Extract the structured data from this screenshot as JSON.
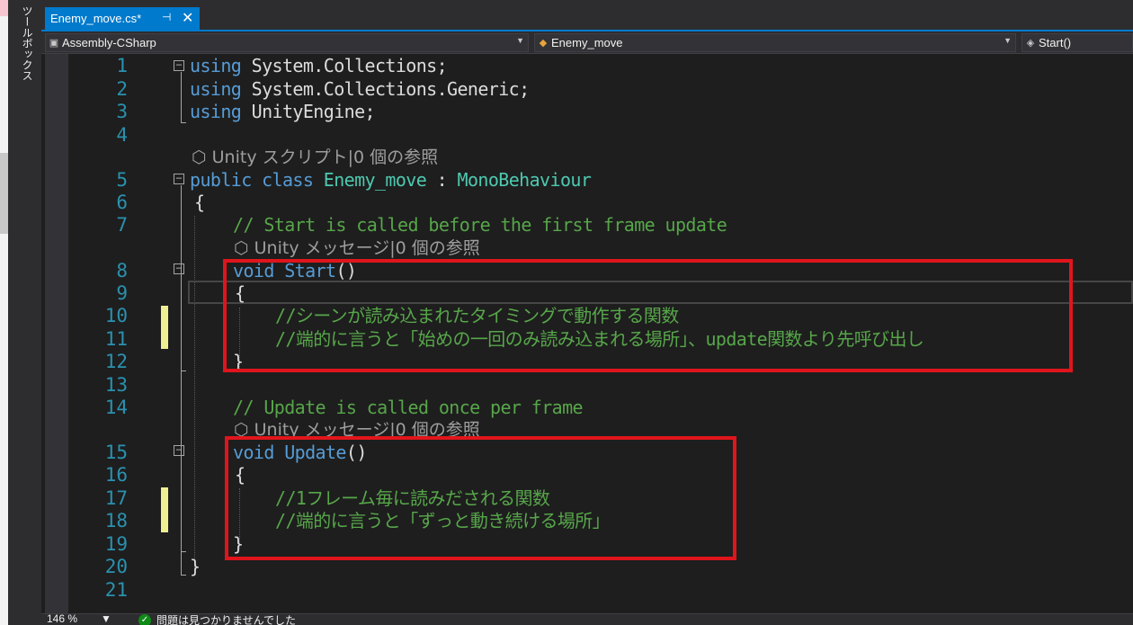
{
  "toolbox": {
    "label": "ツールボックス"
  },
  "tab": {
    "title": "Enemy_move.cs*",
    "pin_glyph": "⊣",
    "close_glyph": "✕"
  },
  "navbar": {
    "project": "Assembly-CSharp",
    "class": "Enemy_move",
    "member": "Start()"
  },
  "editor": {
    "line_numbers": [
      "1",
      "2",
      "3",
      "4",
      "5",
      "6",
      "7",
      "8",
      "9",
      "10",
      "11",
      "12",
      "13",
      "14",
      "15",
      "16",
      "17",
      "18",
      "19",
      "20",
      "21"
    ],
    "lines": {
      "l1": {
        "kw": "using",
        "rest": " System.Collections;"
      },
      "l2": {
        "kw": "using",
        "rest": " System.Collections.Generic;"
      },
      "l3": {
        "kw": "using",
        "rest": " UnityEngine;"
      },
      "lens1": "Unity スクリプト|0 個の参照",
      "l5": {
        "kw1": "public",
        "kw2": "class",
        "name": "Enemy_move",
        "colon": " : ",
        "base": "MonoBehaviour"
      },
      "l6": "{",
      "l7": "// Start is called before the first frame update",
      "lens2": "Unity メッセージ|0 個の参照",
      "l8": {
        "kw": "void",
        "name": "Start",
        "paren": "()"
      },
      "l9": "{",
      "l10": "//シーンが読み込まれたタイミングで動作する関数",
      "l11": "//端的に言うと「始めの一回のみ読み込まれる場所」、update関数より先呼び出し",
      "l12": "}",
      "l14": "// Update is called once per frame",
      "lens3": "Unity メッセージ|0 個の参照",
      "l15": {
        "kw": "void",
        "name": "Update",
        "paren": "()"
      },
      "l16": "{",
      "l17": "//1フレーム毎に読みだされる関数",
      "l18": "//端的に言うと「ずっと動き続ける場所」",
      "l19": "}",
      "l20": "}"
    }
  },
  "statusbar": {
    "zoom": "146 %",
    "issues": "問題は見つかりませんでした"
  },
  "colors": {
    "keyword": "#569cd6",
    "type": "#4ec9b0",
    "comment": "#57a64a",
    "line_number": "#2b91af",
    "accent": "#007acc",
    "annotation_box": "#e0151c",
    "change_marker": "#efef91"
  },
  "icons": [
    "pin-icon",
    "close-icon",
    "project-icon",
    "class-icon",
    "method-icon",
    "dropdown-icon",
    "unity-cube-icon",
    "fold-icon",
    "check-icon"
  ]
}
